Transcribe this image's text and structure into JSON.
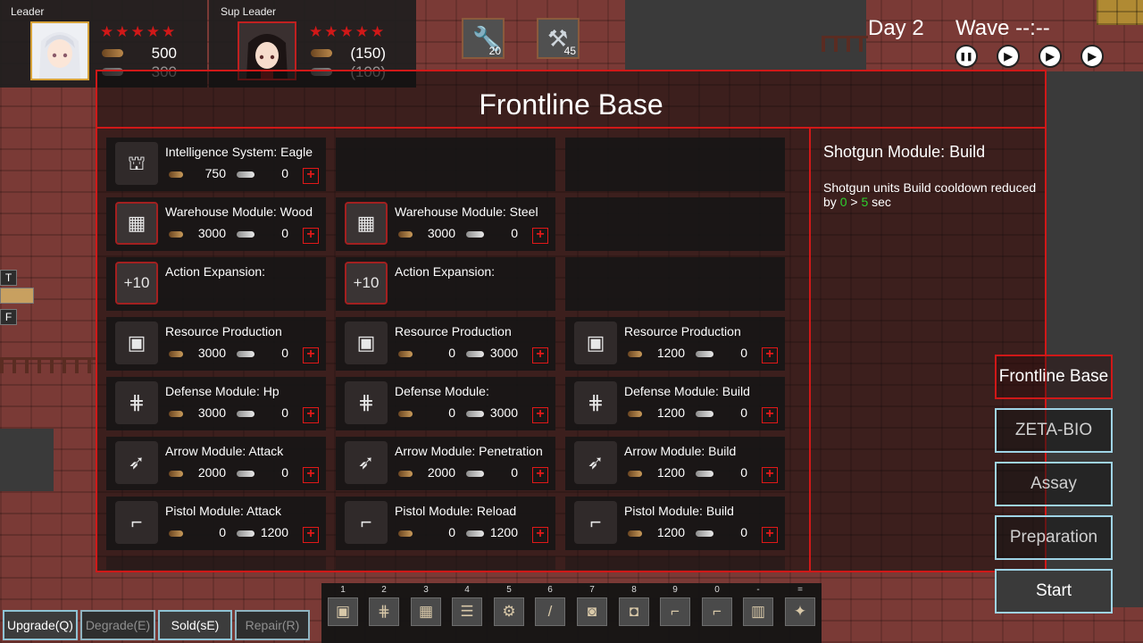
{
  "leader": {
    "label": "Leader",
    "stars": "★★★★★",
    "wood": "500",
    "steel": "300"
  },
  "sup_leader": {
    "label": "Sup Leader",
    "stars": "★★★★★",
    "wood": "(150)",
    "steel": "(100)"
  },
  "tools": [
    {
      "icon": "wrench-icon",
      "glyph": "🔧",
      "count": "20"
    },
    {
      "icon": "crossed-tools-icon",
      "glyph": "⚒",
      "count": "45"
    }
  ],
  "status": {
    "day": "Day 2",
    "wave": "Wave --:--"
  },
  "speed_controls": [
    {
      "icon": "pause-icon",
      "glyph": "❚❚"
    },
    {
      "icon": "play-icon",
      "glyph": "▶"
    },
    {
      "icon": "fast-forward-icon",
      "glyph": "▶"
    },
    {
      "icon": "fastest-forward-icon",
      "glyph": "▶"
    }
  ],
  "side_tags": [
    "T",
    "F"
  ],
  "panel": {
    "title": "Frontline Base",
    "rows": [
      [
        {
          "name": "Intelligence System: Eagle",
          "icon": "tower-icon",
          "glyph": "⛫",
          "wood": "750",
          "steel": "0",
          "plus": "+"
        },
        null,
        null
      ],
      [
        {
          "name": "Warehouse Module: Wood",
          "icon": "warehouse-wood-icon",
          "glyph": "▦",
          "wood": "3000",
          "steel": "0",
          "plus": "+"
        },
        {
          "name": "Warehouse Module: Steel",
          "icon": "warehouse-steel-icon",
          "glyph": "▦",
          "wood": "3000",
          "steel": "0",
          "plus": "+"
        },
        null
      ],
      [
        {
          "name": "Action Expansion:",
          "icon": "plus-ten-icon",
          "glyph": "+10",
          "wood": "",
          "steel": "",
          "plus": ""
        },
        {
          "name": "Action Expansion:",
          "icon": "plus-ten-icon",
          "glyph": "+10",
          "wood": "",
          "steel": "",
          "plus": ""
        },
        null
      ],
      [
        {
          "name": "Resource Production",
          "icon": "chest-icon",
          "glyph": "▣",
          "wood": "3000",
          "steel": "0",
          "plus": "+"
        },
        {
          "name": "Resource Production",
          "icon": "chest-icon",
          "glyph": "▣",
          "wood": "0",
          "steel": "3000",
          "plus": "+"
        },
        {
          "name": "Resource Production",
          "icon": "chest-icon",
          "glyph": "▣",
          "wood": "1200",
          "steel": "0",
          "plus": "+"
        }
      ],
      [
        {
          "name": "Defense Module: Hp",
          "icon": "barricade-icon",
          "glyph": "⋕",
          "wood": "3000",
          "steel": "0",
          "plus": "+"
        },
        {
          "name": "Defense Module:",
          "icon": "barricade-icon",
          "glyph": "⋕",
          "wood": "0",
          "steel": "3000",
          "plus": "+"
        },
        {
          "name": "Defense Module: Build",
          "icon": "barricade-icon",
          "glyph": "⋕",
          "wood": "1200",
          "steel": "0",
          "plus": "+"
        }
      ],
      [
        {
          "name": "Arrow Module: Attack",
          "icon": "crossbow-icon",
          "glyph": "➶",
          "wood": "2000",
          "steel": "0",
          "plus": "+"
        },
        {
          "name": "Arrow Module: Penetration",
          "icon": "crossbow-icon",
          "glyph": "➶",
          "wood": "2000",
          "steel": "0",
          "plus": "+"
        },
        {
          "name": "Arrow Module: Build",
          "icon": "crossbow-icon",
          "glyph": "➶",
          "wood": "1200",
          "steel": "0",
          "plus": "+"
        }
      ],
      [
        {
          "name": "Pistol Module: Attack",
          "icon": "pistol-icon",
          "glyph": "⌐",
          "wood": "0",
          "steel": "1200",
          "plus": "+"
        },
        {
          "name": "Pistol Module: Reload",
          "icon": "pistol-icon",
          "glyph": "⌐",
          "wood": "0",
          "steel": "1200",
          "plus": "+"
        },
        {
          "name": "Pistol Module: Build",
          "icon": "pistol-icon",
          "glyph": "⌐",
          "wood": "1200",
          "steel": "0",
          "plus": "+"
        }
      ]
    ]
  },
  "detail": {
    "title": "Shotgun Module: Build",
    "desc_before": "Shotgun units Build cooldown reduced by ",
    "from": "0",
    "arrow": " > ",
    "to": "5",
    "unit": " sec"
  },
  "menu": {
    "frontline_base": "Frontline Base",
    "zeta_bio": "ZETA-BIO",
    "assay": "Assay",
    "preparation": "Preparation",
    "start": "Start"
  },
  "hotbar": [
    {
      "key": "1",
      "icon": "chest-icon",
      "glyph": "▣"
    },
    {
      "key": "2",
      "icon": "barricade-icon",
      "glyph": "⋕"
    },
    {
      "key": "3",
      "icon": "grate-icon",
      "glyph": "▦"
    },
    {
      "key": "4",
      "icon": "fence-icon",
      "glyph": "☰"
    },
    {
      "key": "5",
      "icon": "drill-icon",
      "glyph": "⚙"
    },
    {
      "key": "6",
      "icon": "blade-icon",
      "glyph": "/"
    },
    {
      "key": "7",
      "icon": "capsule-icon",
      "glyph": "◙"
    },
    {
      "key": "8",
      "icon": "tank-icon",
      "glyph": "◘"
    },
    {
      "key": "9",
      "icon": "rifle-icon",
      "glyph": "⌐"
    },
    {
      "key": "0",
      "icon": "rifle-icon",
      "glyph": "⌐"
    },
    {
      "key": "-",
      "icon": "crate-icon",
      "glyph": "▥"
    },
    {
      "key": "=",
      "icon": "turret-icon",
      "glyph": "✦"
    }
  ],
  "bottom": {
    "upgrade": "Upgrade(Q)",
    "degrade": "Degrade(E)",
    "sold": "Sold(sE)",
    "repair": "Repair(R)"
  }
}
